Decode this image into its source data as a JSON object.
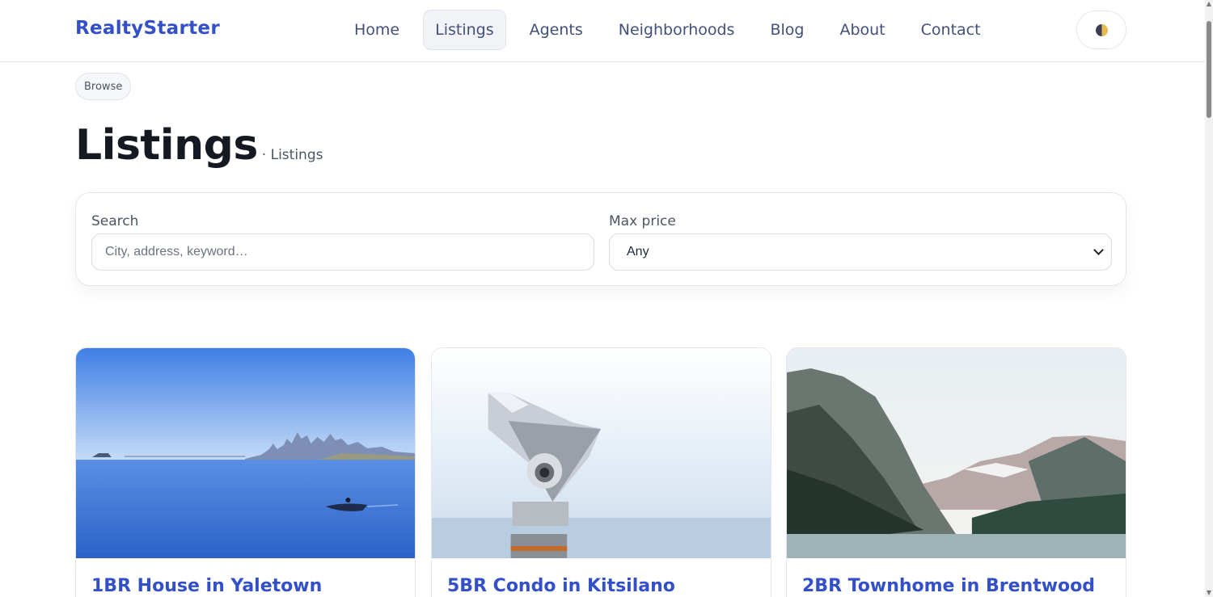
{
  "brand": "RealtyStarter",
  "nav": {
    "items": [
      {
        "label": "Home"
      },
      {
        "label": "Listings",
        "active": true
      },
      {
        "label": "Agents"
      },
      {
        "label": "Neighborhoods"
      },
      {
        "label": "Blog"
      },
      {
        "label": "About"
      },
      {
        "label": "Contact"
      }
    ],
    "theme_toggle_icon": "half-moon-icon"
  },
  "breadcrumb": "Browse",
  "page": {
    "title": "Listings",
    "subtitle": "· Listings"
  },
  "filters": {
    "search_label": "Search",
    "search_placeholder": "City, address, keyword…",
    "search_value": "",
    "price_label": "Max price",
    "price_value": "Any"
  },
  "listings": [
    {
      "title": "1BR House in Yaletown",
      "image": "city-skyline-bay-photo"
    },
    {
      "title": "5BR Condo in Kitsilano",
      "image": "coin-binoculars-photo"
    },
    {
      "title": "2BR Townhome in Brentwood",
      "image": "mountain-lake-photo"
    }
  ],
  "colors": {
    "brand": "#3350c8",
    "nav_text": "#43507a",
    "title": "#151a22"
  }
}
